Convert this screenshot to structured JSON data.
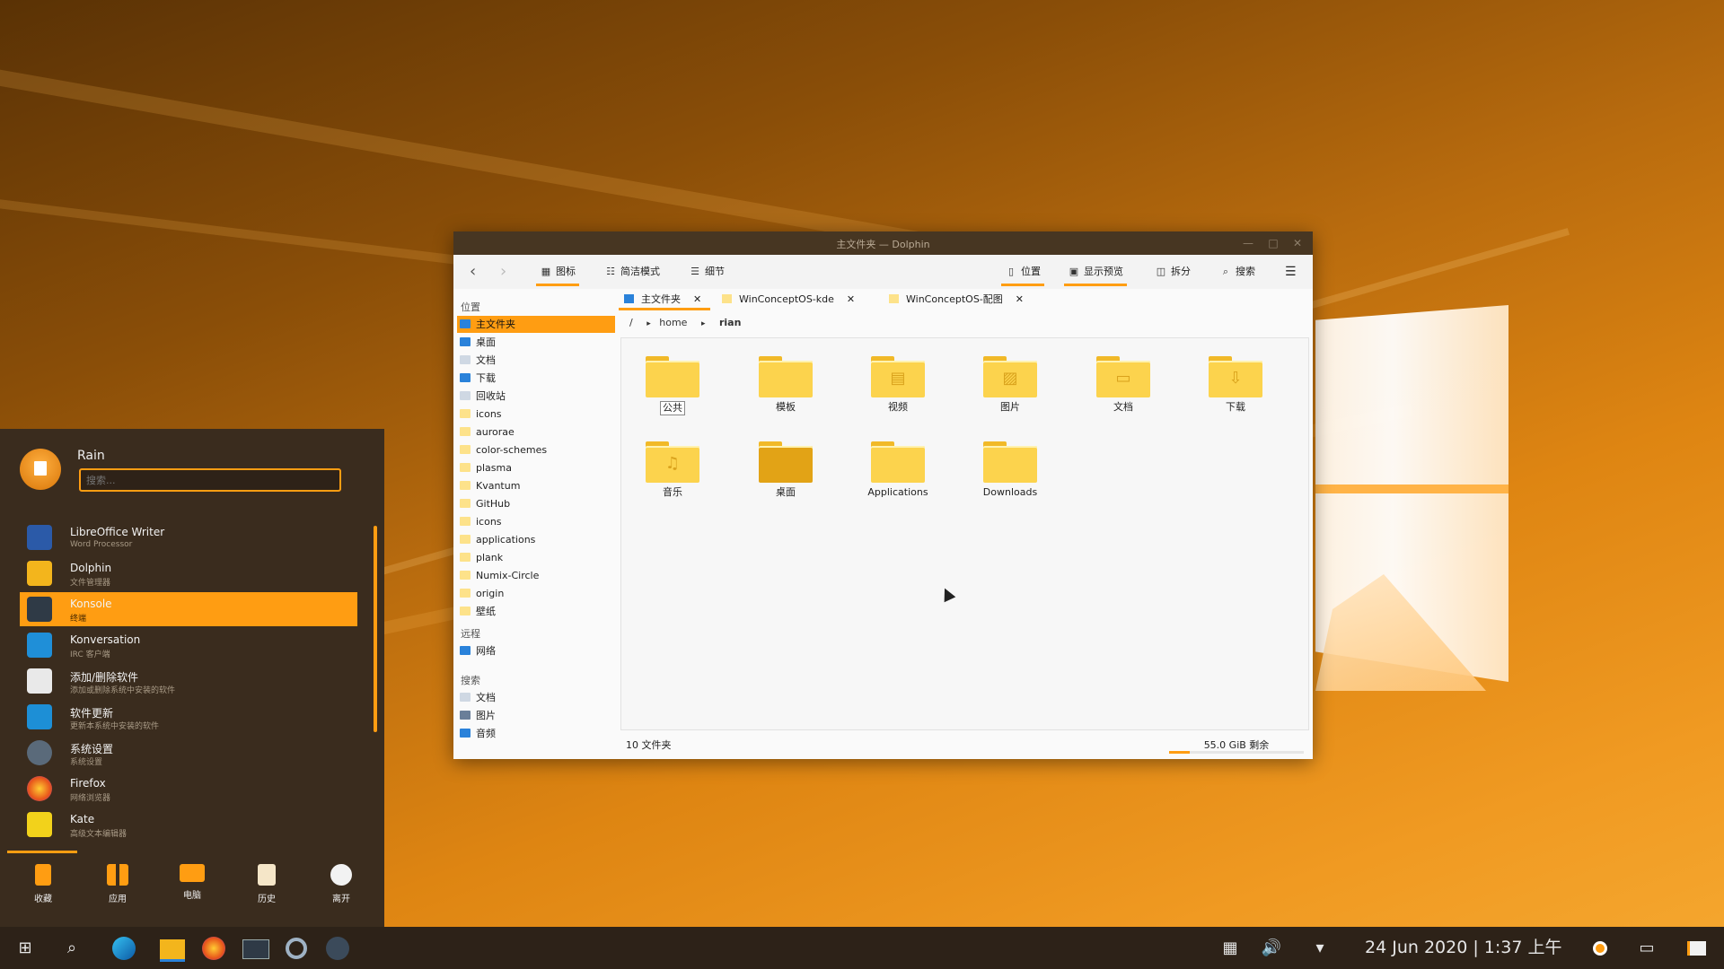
{
  "window": {
    "title": "主文件夹 — Dolphin",
    "minimize_glyph": "—",
    "maximize_glyph": "□",
    "close_glyph": "✕"
  },
  "toolbar": {
    "back_glyph": "‹",
    "forward_glyph": "›",
    "icons_label": "图标",
    "compact_label": "简洁模式",
    "details_label": "细节",
    "location_label": "位置",
    "preview_label": "显示预览",
    "split_label": "拆分",
    "search_label": "搜索",
    "menu_glyph": "☰"
  },
  "places": {
    "places_header": "位置",
    "items": [
      {
        "label": "主文件夹"
      },
      {
        "label": "桌面"
      },
      {
        "label": "文档"
      },
      {
        "label": "下载"
      },
      {
        "label": "回收站"
      },
      {
        "label": "icons"
      },
      {
        "label": "aurorae"
      },
      {
        "label": "color-schemes"
      },
      {
        "label": "plasma"
      },
      {
        "label": "Kvantum"
      },
      {
        "label": "GitHub"
      },
      {
        "label": "icons"
      },
      {
        "label": "applications"
      },
      {
        "label": "plank"
      },
      {
        "label": "Numix-Circle"
      },
      {
        "label": "origin"
      },
      {
        "label": "壁纸"
      }
    ],
    "remote_header": "远程",
    "remote_items": [
      {
        "label": "网络"
      }
    ],
    "search_header": "搜索",
    "search_items": [
      {
        "label": "文档"
      },
      {
        "label": "图片"
      },
      {
        "label": "音频"
      }
    ]
  },
  "tabs": [
    {
      "label": "主文件夹",
      "close": "✕"
    },
    {
      "label": "WinConceptOS-kde",
      "close": "✕"
    },
    {
      "label": "WinConceptOS-配图",
      "close": "✕"
    }
  ],
  "breadcrumb": {
    "root": "/",
    "sep": "▸",
    "items": [
      "home",
      "rian"
    ]
  },
  "folders": [
    {
      "label": "公共"
    },
    {
      "label": "模板"
    },
    {
      "label": "视频",
      "glyph": "▤"
    },
    {
      "label": "图片",
      "glyph": "▨"
    },
    {
      "label": "文档",
      "glyph": "▭"
    },
    {
      "label": "下载",
      "glyph": "⇩"
    },
    {
      "label": "音乐",
      "glyph": "♫"
    },
    {
      "label": "桌面"
    },
    {
      "label": "Applications"
    },
    {
      "label": "Downloads"
    }
  ],
  "status": {
    "count": "10 文件夹",
    "free": "55.0 GiB 剩余",
    "used_fraction": 0.15
  },
  "start_menu": {
    "user": "Rain",
    "search_placeholder": "搜索...",
    "apps": [
      {
        "name": "LibreOffice Writer",
        "desc": "Word Processor"
      },
      {
        "name": "Dolphin",
        "desc": "文件管理器"
      },
      {
        "name": "Konsole",
        "desc": "终端"
      },
      {
        "name": "Konversation",
        "desc": "IRC 客户端"
      },
      {
        "name": "添加/删除软件",
        "desc": "添加或删除系统中安装的软件"
      },
      {
        "name": "软件更新",
        "desc": "更新本系统中安装的软件"
      },
      {
        "name": "系统设置",
        "desc": "系统设置"
      },
      {
        "name": "Firefox",
        "desc": "网络浏览器"
      },
      {
        "name": "Kate",
        "desc": "高级文本编辑器"
      }
    ],
    "favorites": [
      {
        "label": "收藏"
      },
      {
        "label": "应用"
      },
      {
        "label": "电脑"
      },
      {
        "label": "历史"
      },
      {
        "label": "离开"
      }
    ]
  },
  "taskbar": {
    "clock": "24 Jun 2020 | 1:37 上午"
  },
  "colors": {
    "accent": "#ff9d12",
    "titlebar": "#473622",
    "menu_bg": "#3a2c1e",
    "taskbar_bg": "#2d2218"
  }
}
